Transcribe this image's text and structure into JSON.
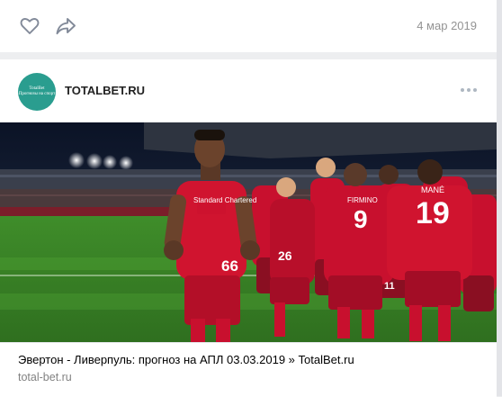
{
  "top_bar": {
    "date": "4 мар 2019"
  },
  "post": {
    "avatar_text": [
      "TotalBet",
      "Прогнозы на спорт"
    ],
    "author": "TOTALBET.RU"
  },
  "photo": {
    "players": [
      {
        "name": "FIRMINO",
        "number": "9"
      },
      {
        "name": "MANÉ",
        "number": "19"
      },
      {
        "name": "",
        "number": "66"
      },
      {
        "name": "",
        "number": "26"
      },
      {
        "name": "",
        "number": "11"
      }
    ],
    "sponsor": "Standard Chartered"
  },
  "snippet": {
    "title": "Эвертон - Ливерпуль: прогноз на АПЛ 03.03.2019 » TotalBet.ru",
    "domain": "total-bet.ru"
  },
  "colors": {
    "accent": "#2a9d8f",
    "link_gray": "#828282",
    "icon_gray": "#aeb7c2"
  }
}
